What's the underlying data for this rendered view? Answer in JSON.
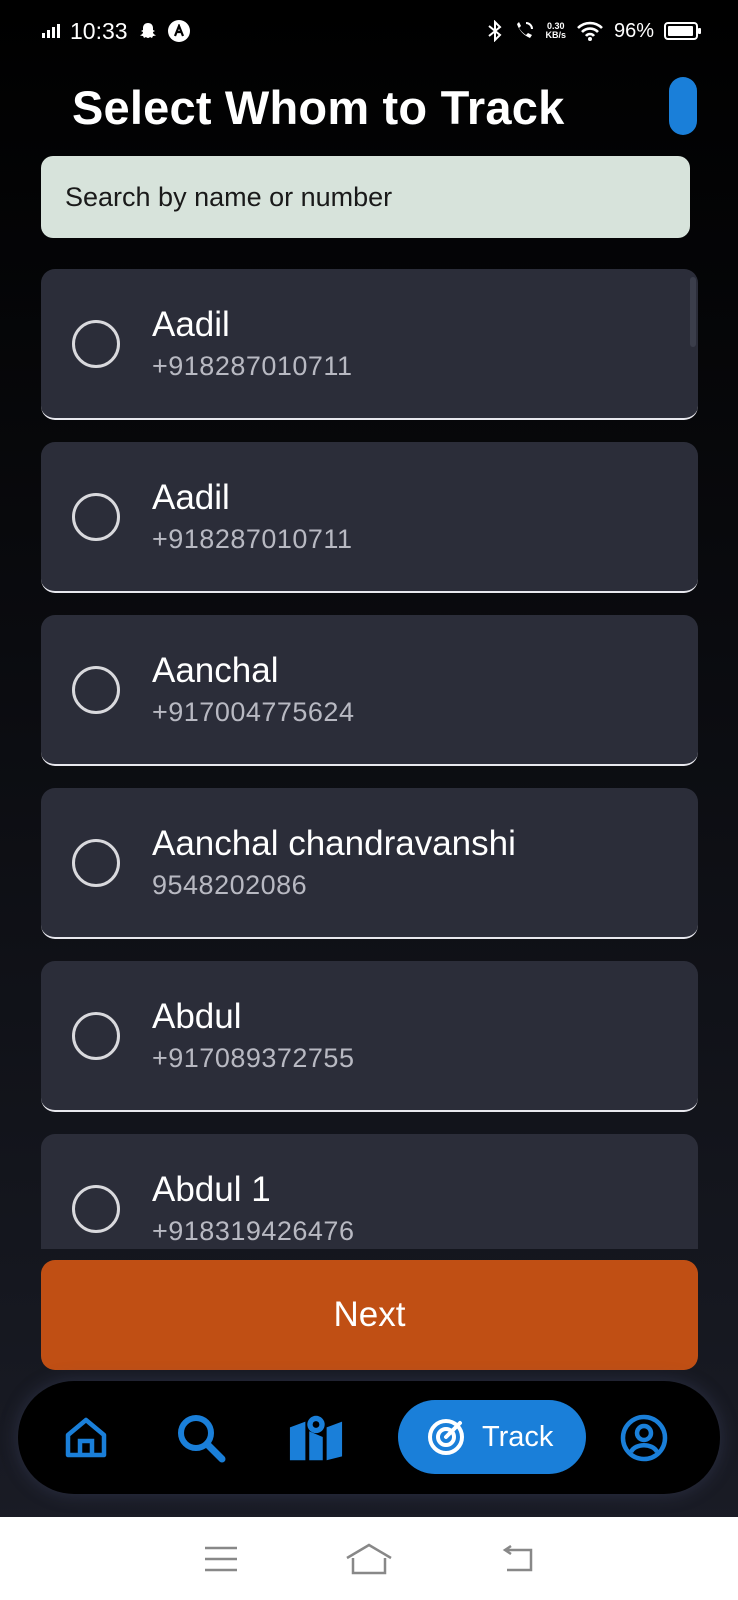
{
  "status_bar": {
    "time": "10:33",
    "speed_value": "0.30",
    "speed_unit": "KB/s",
    "battery": "96%"
  },
  "header": {
    "title": "Select Whom to Track"
  },
  "search": {
    "placeholder": "Search by name or number"
  },
  "contacts": [
    {
      "name": "Aadil",
      "phone": "+918287010711",
      "selected": false
    },
    {
      "name": "Aadil",
      "phone": "+918287010711",
      "selected": false
    },
    {
      "name": "Aanchal",
      "phone": "+917004775624",
      "selected": false
    },
    {
      "name": "Aanchal chandravanshi",
      "phone": "9548202086",
      "selected": false
    },
    {
      "name": "Abdul",
      "phone": "+917089372755",
      "selected": false
    },
    {
      "name": "Abdul 1",
      "phone": "+918319426476",
      "selected": false
    }
  ],
  "actions": {
    "next_label": "Next"
  },
  "bottom_nav": {
    "items": [
      {
        "icon": "home-icon"
      },
      {
        "icon": "search-icon"
      },
      {
        "icon": "map-icon"
      },
      {
        "icon": "radar-icon",
        "label": "Track",
        "active": true
      },
      {
        "icon": "profile-icon"
      }
    ]
  },
  "colors": {
    "accent": "#1a7fd9",
    "next_button": "#c04f14",
    "card": "#2b2d39",
    "search_bg": "#d7e3db"
  }
}
